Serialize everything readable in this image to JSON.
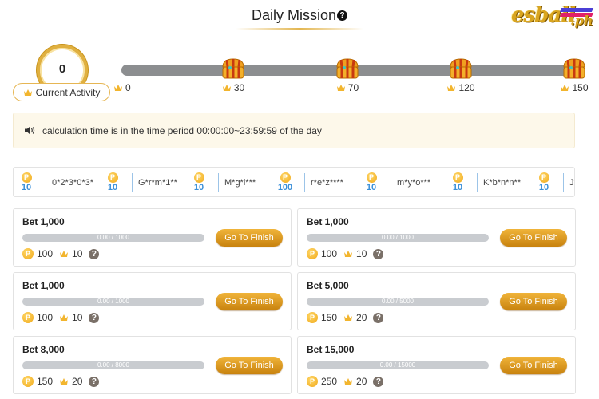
{
  "header": {
    "title": "Daily Mission",
    "help_glyph": "?",
    "logo_text": "esball",
    "logo_suffix": ".ph"
  },
  "activity": {
    "current_value": "0",
    "label": "Current Activity",
    "progress_fraction": 0,
    "start_label": "0",
    "milestones": [
      {
        "value": "30",
        "icon": "treasure-chest-icon"
      },
      {
        "value": "70",
        "icon": "treasure-chest-icon"
      },
      {
        "value": "120",
        "icon": "treasure-chest-icon"
      },
      {
        "value": "150",
        "icon": "treasure-chest-icon"
      }
    ]
  },
  "notice": {
    "icon": "speaker-icon",
    "text": "calculation time is in the time period 00:00:00~23:59:59 of the day"
  },
  "ticker": {
    "items": [
      {
        "name": "::",
        "amount": "10"
      },
      {
        "name": "0*2*3*0*3*",
        "amount": "10"
      },
      {
        "name": "G*r*m*1**",
        "amount": "10"
      },
      {
        "name": "M*g*l***",
        "amount": "100"
      },
      {
        "name": "r*e*z****",
        "amount": "10"
      },
      {
        "name": "m*y*o***",
        "amount": "10"
      },
      {
        "name": "K*b*n*n**",
        "amount": "10"
      },
      {
        "name": "J*k*T***",
        "amount": ""
      }
    ],
    "coin_glyph": "P"
  },
  "missions": [
    {
      "title": "Bet 1,000",
      "progress_text": "0.00 / 1000",
      "progress_fraction": 0,
      "coins": "100",
      "activity": "10",
      "button": "Go To Finish"
    },
    {
      "title": "Bet 1,000",
      "progress_text": "0.00 / 1000",
      "progress_fraction": 0,
      "coins": "100",
      "activity": "10",
      "button": "Go To Finish"
    },
    {
      "title": "Bet 1,000",
      "progress_text": "0.00 / 1000",
      "progress_fraction": 0,
      "coins": "100",
      "activity": "10",
      "button": "Go To Finish"
    },
    {
      "title": "Bet 5,000",
      "progress_text": "0.00 / 5000",
      "progress_fraction": 0,
      "coins": "150",
      "activity": "20",
      "button": "Go To Finish"
    },
    {
      "title": "Bet 8,000",
      "progress_text": "0.00 / 8000",
      "progress_fraction": 0,
      "coins": "150",
      "activity": "20",
      "button": "Go To Finish"
    },
    {
      "title": "Bet 15,000",
      "progress_text": "0.00 / 15000",
      "progress_fraction": 0,
      "coins": "250",
      "activity": "20",
      "button": "Go To Finish"
    }
  ],
  "colors": {
    "accent_gold": "#e0a020",
    "track_gray": "#8c8e90",
    "ticker_amount": "#3a8fd8",
    "notice_bg": "#fdf8ea"
  }
}
